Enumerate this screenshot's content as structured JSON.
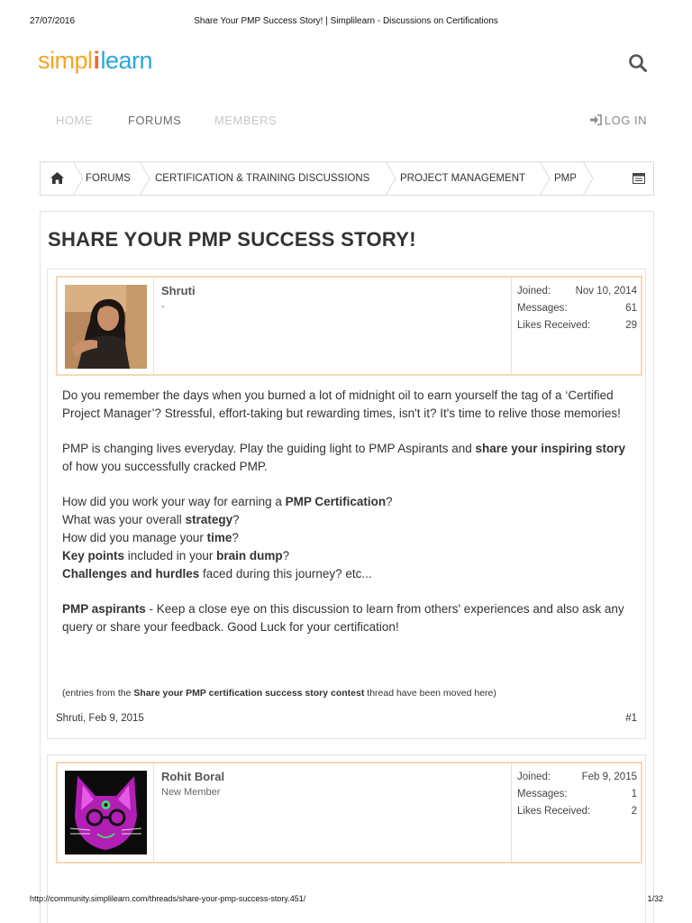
{
  "print_header": {
    "date": "27/07/2016",
    "title": "Share Your PMP Success Story! | Simplilearn - Discussions on Certifications"
  },
  "logo": {
    "part1": "simpl",
    "part2": "i",
    "part3": "learn"
  },
  "nav": {
    "home": "HOME",
    "forums": "FORUMS",
    "members": "MEMBERS",
    "login": "LOG IN"
  },
  "breadcrumb": [
    "FORUMS",
    "CERTIFICATION & TRAINING DISCUSSIONS",
    "PROJECT MANAGEMENT",
    "PMP"
  ],
  "thread_title": "SHARE YOUR PMP SUCCESS STORY!",
  "stat_labels": {
    "joined": "Joined:",
    "messages": "Messages:",
    "likes": "Likes Received:"
  },
  "posts": [
    {
      "author": "Shruti",
      "user_title": "-",
      "joined": "Nov 10, 2014",
      "messages": "61",
      "likes": "29",
      "footer_author_date": "Shruti, Feb 9, 2015",
      "post_number": "#1"
    },
    {
      "author": "Rohit Boral",
      "user_title": "New Member",
      "joined": "Feb 9, 2015",
      "messages": "1",
      "likes": "2"
    }
  ],
  "message": {
    "p1": "Do you remember the days when you burned a lot of midnight oil to earn yourself the tag of a ‘Certified Project Manager’? Stressful, effort-taking but rewarding times, isn't it? It's time to relive those memories!",
    "p2_a": "PMP is changing lives everyday. Play the guiding light to PMP Aspirants and ",
    "p2_b": "share your inspiring story",
    "p2_c": " of how you successfully cracked PMP.",
    "q1_a": "How did you work your way for earning a ",
    "q1_b": "PMP Certification",
    "q1_c": "?",
    "q2_a": "What was your overall ",
    "q2_b": "strategy",
    "q2_c": "?",
    "q3_a": "How did you manage your ",
    "q3_b": "time",
    "q3_c": "?",
    "q4_a": "Key points",
    "q4_b": " included in your ",
    "q4_c": "brain dump",
    "q4_d": "?",
    "q5_a": "Challenges and hurdles",
    "q5_b": " faced during this journey? etc...",
    "p4_a": "PMP aspirants",
    "p4_b": " - Keep a close eye on this discussion to learn from others' experiences and also ask any query or share your feedback. Good Luck for your certification!",
    "contest_a": "(entries from the ",
    "contest_b": "Share your PMP certification success story contest",
    "contest_c": " thread have been moved here)"
  },
  "print_footer": {
    "url": "http://community.simplilearn.com/threads/share-your-pmp-success-story.451/",
    "page": "1/32"
  },
  "colors": {
    "logo_yellow": "#f5a623",
    "logo_orange": "#ef6a2a",
    "logo_blue": "#2aa7dc",
    "userbar_border": "#f6d8b6"
  },
  "icons": {
    "search": "search-icon",
    "home": "home-icon",
    "login": "login-icon",
    "menu": "menu-icon"
  }
}
